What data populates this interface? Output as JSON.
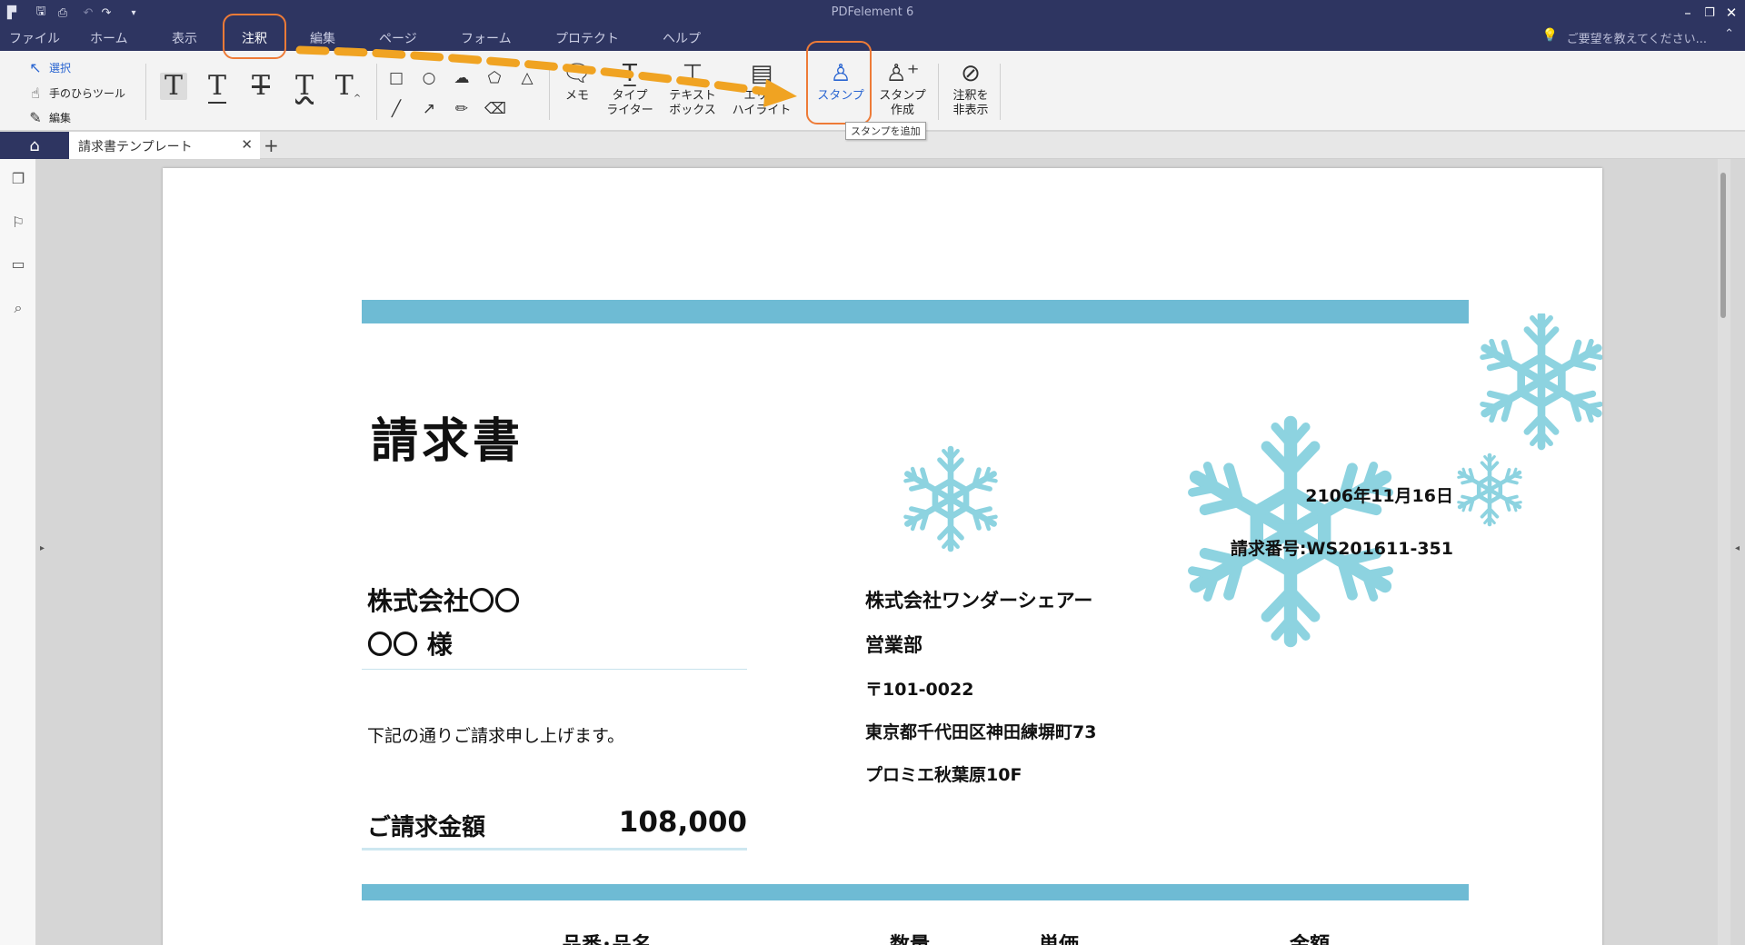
{
  "window": {
    "title": "PDFelement 6",
    "min_icon": "minimize-icon",
    "max_icon": "maximize-icon",
    "close_icon": "close-icon"
  },
  "menu": {
    "items": [
      "ファイル",
      "ホーム",
      "表示",
      "注釈",
      "編集",
      "ページ",
      "フォーム",
      "プロテクト",
      "ヘルプ"
    ],
    "active": "注釈",
    "feedback": "ご要望を教えてください..."
  },
  "ribbon": {
    "select_tools": [
      "選択",
      "手のひらツール",
      "編集"
    ],
    "text_markup_tools": [
      "text-highlight-icon",
      "underline-icon",
      "strikethrough-icon",
      "squiggly-icon",
      "caret-icon"
    ],
    "shape_tools": [
      "rectangle-icon",
      "oval-icon",
      "cloud-icon",
      "polygon-icon",
      "triangle-icon",
      "line-icon",
      "arrow-icon",
      "pencil-icon",
      "eraser-icon"
    ],
    "buttons": [
      {
        "label": "メモ",
        "icon": "note-icon"
      },
      {
        "label": "タイプ\nライター",
        "icon": "typewriter-icon"
      },
      {
        "label": "テキスト\nボックス",
        "icon": "textbox-icon"
      },
      {
        "label": "エリア\nハイライト",
        "icon": "area-highlight-icon"
      },
      {
        "label": "スタンプ",
        "icon": "stamp-icon"
      },
      {
        "label": "スタンプ\n作成",
        "icon": "create-stamp-icon"
      },
      {
        "label": "注釈を\n非表示",
        "icon": "hide-annotations-icon"
      }
    ],
    "tooltip": "スタンプを追加"
  },
  "tabs": {
    "home_icon": "home-icon",
    "document_tab": "請求書テンプレート",
    "close_icon": "close-icon",
    "new_tab_icon": "plus-icon"
  },
  "sidebar": {
    "icons": [
      "pages-icon",
      "bookmark-icon",
      "comment-icon",
      "search-icon"
    ]
  },
  "document": {
    "title": "請求書",
    "date": "2106年11月16日",
    "invoice_number": "請求番号:WS201611-351",
    "client_company": "株式会社〇〇",
    "client_name": "〇〇 様",
    "intro": "下記の通りご請求申し上げます。",
    "amount_label": "ご請求金額",
    "amount_value": "108,000",
    "sender": {
      "company": "株式会社ワンダーシェアー",
      "department": "営業部",
      "zip": "〒101-0022",
      "address": "東京都千代田区神田練塀町73",
      "building": "プロミエ秋葉原10F"
    },
    "table_headers": [
      "品番･品名",
      "数量",
      "単価",
      "金額"
    ],
    "accent_color": "#6ebbd4",
    "decoration": "snowflake-icon"
  },
  "annotation_color": "#ee7b37"
}
